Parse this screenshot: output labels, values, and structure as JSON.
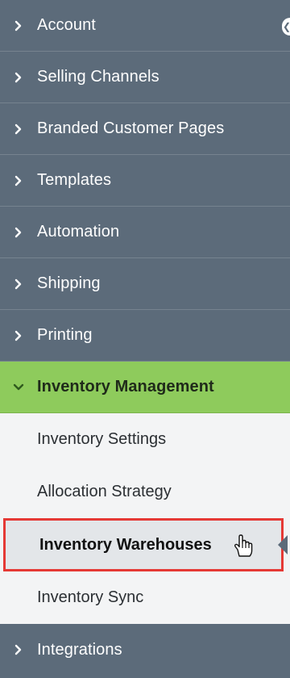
{
  "sidebar": {
    "items": [
      {
        "label": "Account",
        "icon": "chevron-right-icon"
      },
      {
        "label": "Selling Channels",
        "icon": "chevron-right-icon"
      },
      {
        "label": "Branded Customer Pages",
        "icon": "chevron-right-icon"
      },
      {
        "label": "Templates",
        "icon": "chevron-right-icon"
      },
      {
        "label": "Automation",
        "icon": "chevron-right-icon"
      },
      {
        "label": "Shipping",
        "icon": "chevron-right-icon"
      },
      {
        "label": "Printing",
        "icon": "chevron-right-icon"
      },
      {
        "label": "Inventory Management",
        "icon": "chevron-down-icon",
        "expanded": true
      },
      {
        "label": "Integrations",
        "icon": "chevron-right-icon"
      }
    ],
    "inventory_sub": [
      {
        "label": "Inventory Settings"
      },
      {
        "label": "Allocation Strategy"
      },
      {
        "label": "Inventory Warehouses",
        "selected": true
      },
      {
        "label": "Inventory Sync"
      }
    ]
  },
  "colors": {
    "sidebar_bg": "#5c6b7a",
    "active_bg": "#8ecb5c",
    "highlight_border": "#e53935",
    "submenu_bg": "#f3f4f5"
  }
}
